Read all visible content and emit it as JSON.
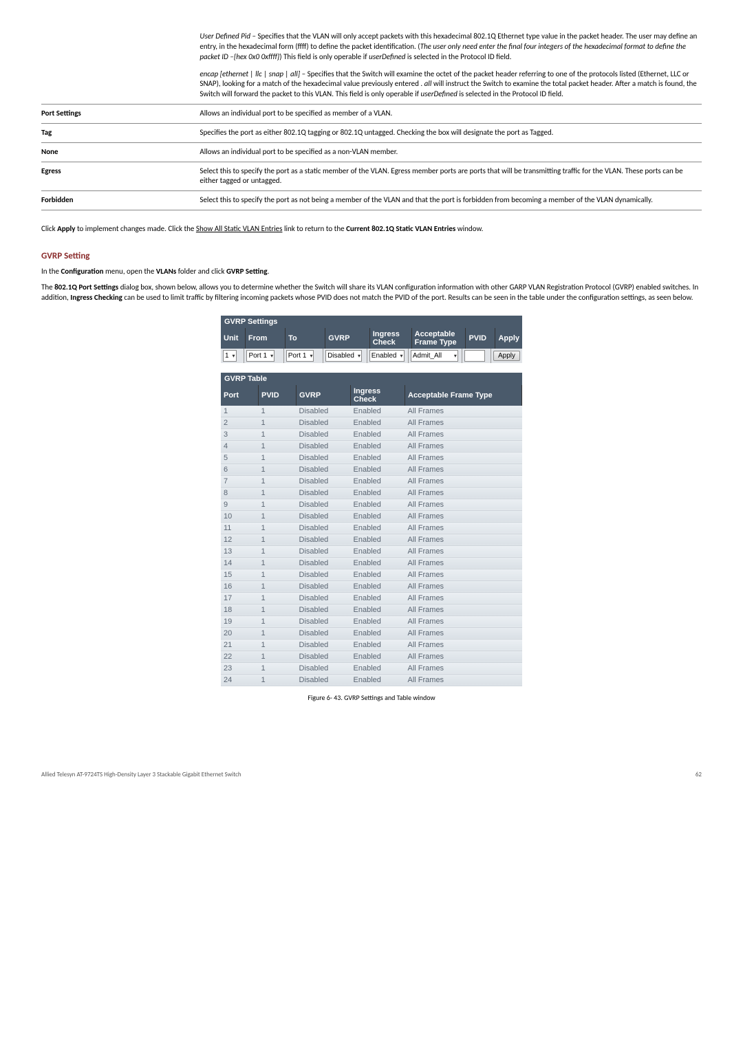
{
  "def_table": {
    "rows": [
      {
        "label": "",
        "html_parts": [
          {
            "text": "User Defined Pid",
            "italic": true
          },
          {
            "text": " – Specifies that the VLAN will only accept packets with this hexadecimal 802.1Q Ethernet type value in the packet header. The user may define an entry, in the hexadecimal form (ffff) to define the packet identification. ("
          },
          {
            "text": "The user only need enter the final four integers of the hexadecimal format to define the packet ID –{hex 0x0 0xffff}",
            "italic": true
          },
          {
            "text": ") This field is only operable if "
          },
          {
            "text": "userDefined",
            "italic": true
          },
          {
            "text": " is selected in the Protocol ID field."
          }
        ],
        "second_para": [
          {
            "text": "encap [ethernet | llc | snap | all]",
            "italic": true
          },
          {
            "text": " – Specifies that the Switch will examine the octet of the packet header referring to one of the protocols listed (Ethernet, LLC or SNAP), looking for a match of the hexadecimal value previously entered . "
          },
          {
            "text": "all",
            "italic": true
          },
          {
            "text": " will instruct the Switch to examine the total packet header. After a match is found, the Switch will forward the packet to this VLAN. This field is only operable if "
          },
          {
            "text": "userDefined",
            "italic": true
          },
          {
            "text": " is selected in the Protocol ID field."
          }
        ]
      },
      {
        "label": "Port Settings",
        "desc": "Allows an individual port to be specified as member of a VLAN."
      },
      {
        "label": "Tag",
        "desc": "Specifies the port as either 802.1Q tagging or 802.1Q untagged. Checking the box will designate the port as Tagged."
      },
      {
        "label": "None",
        "desc": "Allows an individual port to be specified as a non-VLAN member."
      },
      {
        "label": "Egress",
        "desc": "Select this to specify the port as a static member of the VLAN. Egress member ports are ports that will be transmitting traffic for the VLAN. These ports can be either tagged or untagged."
      },
      {
        "label": "Forbidden",
        "desc": "Select this to specify the port as not being a member of the VLAN and that the port is forbidden from becoming a member of the VLAN dynamically."
      }
    ]
  },
  "apply_line": {
    "prefix": "Click ",
    "apply": "Apply",
    "mid": " to implement changes made. Click the ",
    "link": "Show All Static VLAN Entries",
    "mid2": " link to return to the ",
    "bold2": "Current 802.1Q Static VLAN Entries",
    "suffix": " window."
  },
  "section_heading": "GVRP Setting",
  "config_line": {
    "p1": "In the ",
    "b1": "Configuration",
    "p2": " menu, open the ",
    "b2": "VLANs",
    "p3": " folder and click ",
    "b3": "GVRP Setting",
    "p4": "."
  },
  "desc_para": {
    "p1": "The ",
    "b1": "802.1Q Port Settings",
    "p2": " dialog box, shown below, allows you to determine whether the Switch will share its VLAN configuration information with other GARP VLAN Registration Protocol (GVRP) enabled switches. In addition, ",
    "b2": "Ingress Checking",
    "p3": " can be used to limit traffic by filtering incoming packets whose PVID does not match the PVID of the port. Results can be seen in the table under the configuration settings, as seen below."
  },
  "gvrp_settings": {
    "title": "GVRP Settings",
    "headers": [
      "Unit",
      "From",
      "To",
      "GVRP",
      "Ingress Check",
      "Acceptable Frame Type",
      "PVID",
      "Apply"
    ],
    "row": {
      "unit": "1",
      "from": "Port 1",
      "to": "Port 1",
      "gvrp": "Disabled",
      "ingress": "Enabled",
      "aft": "Admit_All",
      "apply_btn": "Apply"
    }
  },
  "gvrp_table": {
    "title": "GVRP Table",
    "headers": [
      "Port",
      "PVID",
      "GVRP",
      "Ingress Check",
      "Acceptable Frame Type"
    ],
    "rows": [
      {
        "port": "1",
        "pvid": "1",
        "gvrp": "Disabled",
        "ing": "Enabled",
        "aft": "All Frames"
      },
      {
        "port": "2",
        "pvid": "1",
        "gvrp": "Disabled",
        "ing": "Enabled",
        "aft": "All Frames"
      },
      {
        "port": "3",
        "pvid": "1",
        "gvrp": "Disabled",
        "ing": "Enabled",
        "aft": "All Frames"
      },
      {
        "port": "4",
        "pvid": "1",
        "gvrp": "Disabled",
        "ing": "Enabled",
        "aft": "All Frames"
      },
      {
        "port": "5",
        "pvid": "1",
        "gvrp": "Disabled",
        "ing": "Enabled",
        "aft": "All Frames"
      },
      {
        "port": "6",
        "pvid": "1",
        "gvrp": "Disabled",
        "ing": "Enabled",
        "aft": "All Frames"
      },
      {
        "port": "7",
        "pvid": "1",
        "gvrp": "Disabled",
        "ing": "Enabled",
        "aft": "All Frames"
      },
      {
        "port": "8",
        "pvid": "1",
        "gvrp": "Disabled",
        "ing": "Enabled",
        "aft": "All Frames"
      },
      {
        "port": "9",
        "pvid": "1",
        "gvrp": "Disabled",
        "ing": "Enabled",
        "aft": "All Frames"
      },
      {
        "port": "10",
        "pvid": "1",
        "gvrp": "Disabled",
        "ing": "Enabled",
        "aft": "All Frames"
      },
      {
        "port": "11",
        "pvid": "1",
        "gvrp": "Disabled",
        "ing": "Enabled",
        "aft": "All Frames"
      },
      {
        "port": "12",
        "pvid": "1",
        "gvrp": "Disabled",
        "ing": "Enabled",
        "aft": "All Frames"
      },
      {
        "port": "13",
        "pvid": "1",
        "gvrp": "Disabled",
        "ing": "Enabled",
        "aft": "All Frames"
      },
      {
        "port": "14",
        "pvid": "1",
        "gvrp": "Disabled",
        "ing": "Enabled",
        "aft": "All Frames"
      },
      {
        "port": "15",
        "pvid": "1",
        "gvrp": "Disabled",
        "ing": "Enabled",
        "aft": "All Frames"
      },
      {
        "port": "16",
        "pvid": "1",
        "gvrp": "Disabled",
        "ing": "Enabled",
        "aft": "All Frames"
      },
      {
        "port": "17",
        "pvid": "1",
        "gvrp": "Disabled",
        "ing": "Enabled",
        "aft": "All Frames"
      },
      {
        "port": "18",
        "pvid": "1",
        "gvrp": "Disabled",
        "ing": "Enabled",
        "aft": "All Frames"
      },
      {
        "port": "19",
        "pvid": "1",
        "gvrp": "Disabled",
        "ing": "Enabled",
        "aft": "All Frames"
      },
      {
        "port": "20",
        "pvid": "1",
        "gvrp": "Disabled",
        "ing": "Enabled",
        "aft": "All Frames"
      },
      {
        "port": "21",
        "pvid": "1",
        "gvrp": "Disabled",
        "ing": "Enabled",
        "aft": "All Frames"
      },
      {
        "port": "22",
        "pvid": "1",
        "gvrp": "Disabled",
        "ing": "Enabled",
        "aft": "All Frames"
      },
      {
        "port": "23",
        "pvid": "1",
        "gvrp": "Disabled",
        "ing": "Enabled",
        "aft": "All Frames"
      },
      {
        "port": "24",
        "pvid": "1",
        "gvrp": "Disabled",
        "ing": "Enabled",
        "aft": "All Frames"
      }
    ]
  },
  "figure_caption": "Figure 6- 43. GVRP Settings and Table window",
  "footer": {
    "left": "Allied Telesyn AT-9724TS High-Density Layer 3 Stackable Gigabit Ethernet Switch",
    "right": "62"
  }
}
